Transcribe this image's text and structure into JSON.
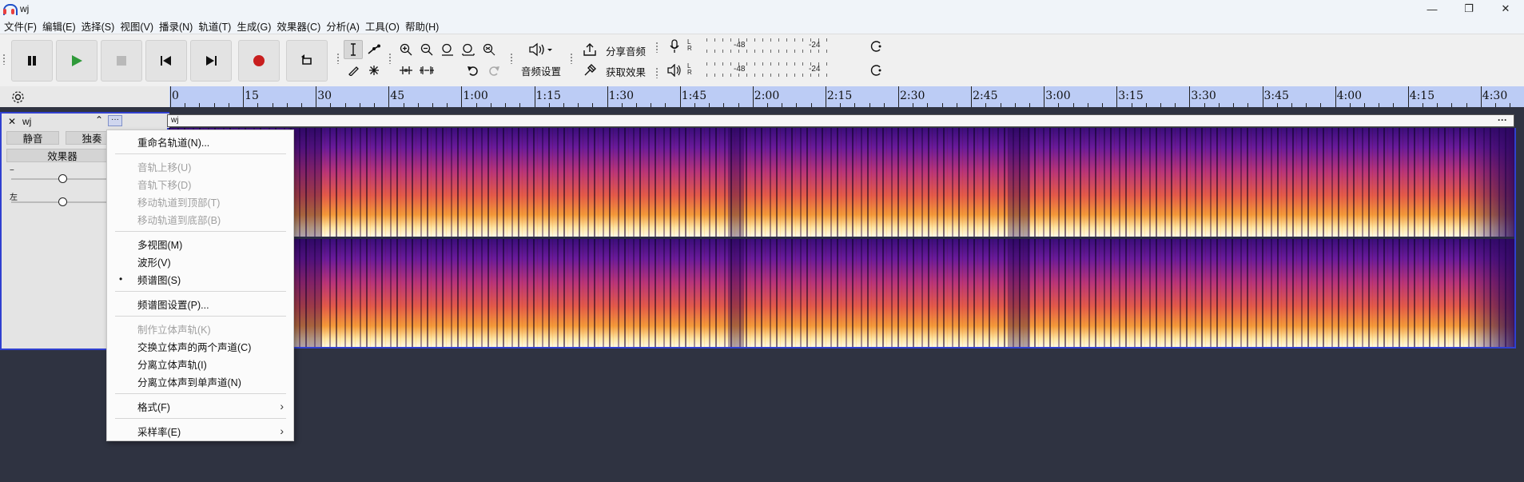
{
  "window": {
    "title": "wj",
    "minimize": "—",
    "maximize": "❐",
    "close": "✕"
  },
  "menu": [
    "文件(F)",
    "编辑(E)",
    "选择(S)",
    "视图(V)",
    "播录(N)",
    "轨道(T)",
    "生成(G)",
    "效果器(C)",
    "分析(A)",
    "工具(O)",
    "帮助(H)"
  ],
  "toolbar": {
    "audio_setup_label": "音频设置",
    "share_audio_label": "分享音频",
    "get_effects_label": "获取效果",
    "meter_ticks": [
      "-48",
      "-24"
    ]
  },
  "timeline": {
    "labels": [
      "0",
      "15",
      "30",
      "45",
      "1:00",
      "1:15",
      "1:30",
      "1:45",
      "2:00",
      "2:15",
      "2:30",
      "2:45",
      "3:00",
      "3:15",
      "3:30",
      "3:45",
      "4:00",
      "4:15",
      "4:30"
    ]
  },
  "track": {
    "name": "wj",
    "mute_label": "静音",
    "solo_label": "独奏",
    "effects_label": "效果器",
    "gain_label": "−",
    "pan_label": "左",
    "clip_name": "wj",
    "menu_dots": "···"
  },
  "context_menu": [
    {
      "label": "重命名轨道(N)...",
      "disabled": false
    },
    {
      "sep": true
    },
    {
      "label": "音轨上移(U)",
      "disabled": true
    },
    {
      "label": "音轨下移(D)",
      "disabled": true
    },
    {
      "label": "移动轨道到顶部(T)",
      "disabled": true
    },
    {
      "label": "移动轨道到底部(B)",
      "disabled": true
    },
    {
      "sep": true
    },
    {
      "label": "多视图(M)",
      "disabled": false
    },
    {
      "label": "波形(V)",
      "disabled": false
    },
    {
      "label": "频谱图(S)",
      "disabled": false,
      "checked": true,
      "bullet": "•"
    },
    {
      "sep": true
    },
    {
      "label": "频谱图设置(P)...",
      "disabled": false
    },
    {
      "sep": true
    },
    {
      "label": "制作立体声轨(K)",
      "disabled": true
    },
    {
      "label": "交换立体声的两个声道(C)",
      "disabled": false
    },
    {
      "label": "分离立体声轨(I)",
      "disabled": false
    },
    {
      "label": "分离立体声到单声道(N)",
      "disabled": false
    },
    {
      "sep": true
    },
    {
      "label": "格式(F)",
      "disabled": false,
      "submenu": true,
      "arrow": "›"
    },
    {
      "sep": true
    },
    {
      "label": "采样率(E)",
      "disabled": false,
      "submenu": true,
      "arrow": "›"
    }
  ]
}
